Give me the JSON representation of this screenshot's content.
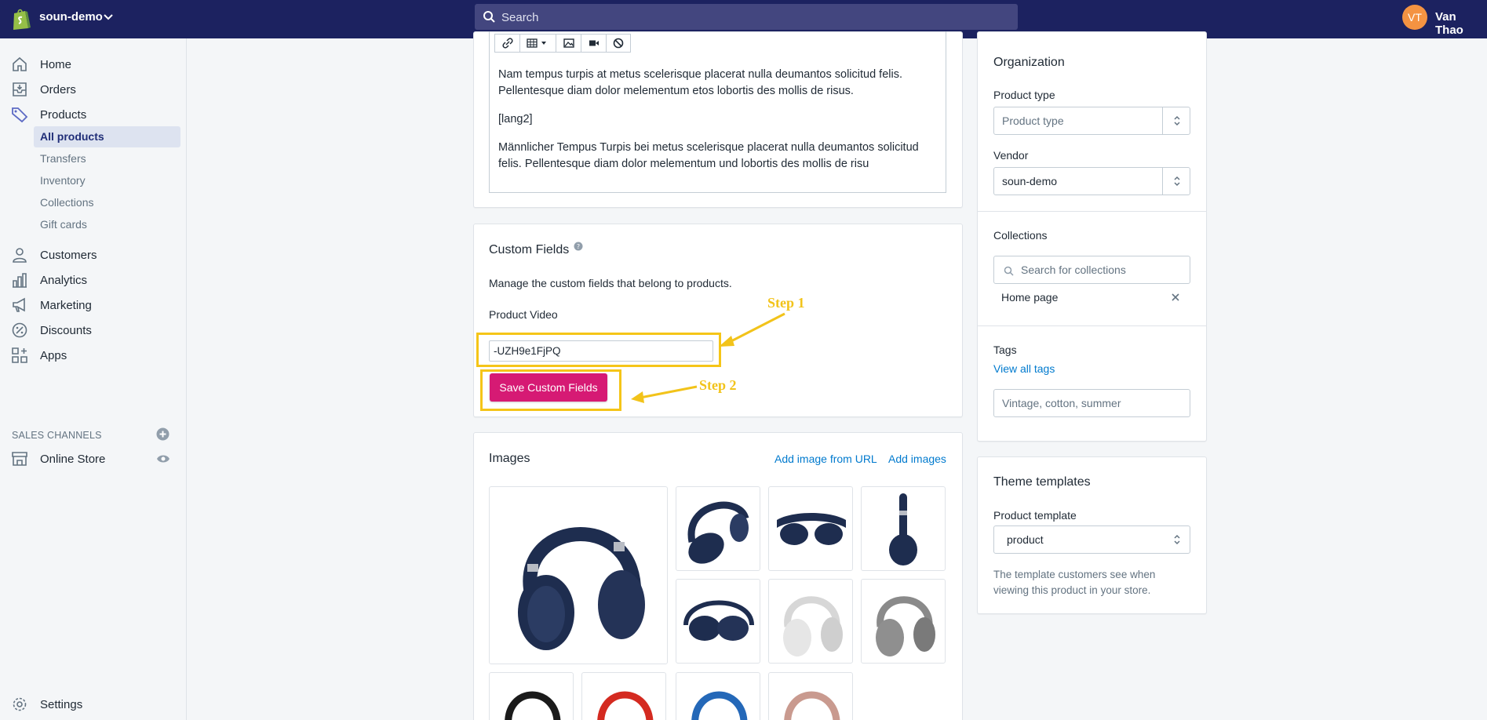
{
  "topbar": {
    "shop_name": "soun-demo",
    "search_placeholder": "Search",
    "avatar_initials": "VT",
    "user_name": "Van Thao"
  },
  "sidebar": {
    "home": "Home",
    "orders": "Orders",
    "products": "Products",
    "sub": [
      "All products",
      "Transfers",
      "Inventory",
      "Collections",
      "Gift cards"
    ],
    "customers": "Customers",
    "analytics": "Analytics",
    "marketing": "Marketing",
    "discounts": "Discounts",
    "apps": "Apps",
    "sales_channels": "SALES CHANNELS",
    "online_store": "Online Store",
    "settings": "Settings"
  },
  "editor": {
    "para1": "Nam tempus turpis at metus scelerisque placerat nulla deumantos solicitud felis. Pellentesque diam dolor melementum etos lobortis des mollis de risus.",
    "para2": "[lang2]",
    "para3": "Männlicher Tempus Turpis bei metus scelerisque placerat nulla deumantos solicitud felis. Pellentesque diam dolor melementum und lobortis des mollis de risu"
  },
  "custom_fields": {
    "title": "Custom Fields",
    "description": "Manage the custom fields that belong to products.",
    "field_label": "Product Video",
    "field_value": "-UZH9e1FjPQ",
    "save_label": "Save Custom Fields",
    "step1": "Step 1",
    "step2": "Step 2"
  },
  "images": {
    "title": "Images",
    "add_url": "Add image from URL",
    "add_images": "Add images"
  },
  "organization": {
    "title": "Organization",
    "product_type_label": "Product type",
    "product_type_placeholder": "Product type",
    "vendor_label": "Vendor",
    "vendor_value": "soun-demo",
    "collections_label": "Collections",
    "collections_placeholder": "Search for collections",
    "collection_item": "Home page",
    "tags_label": "Tags",
    "view_all_tags": "View all tags",
    "tags_placeholder": "Vintage, cotton, summer"
  },
  "theme": {
    "title": "Theme templates",
    "template_label": "Product template",
    "template_value": "product",
    "help": "The template customers see when viewing this product in your store."
  },
  "colors": {
    "topbar": "#1c2260",
    "save_button": "#d61a74",
    "highlight": "#f5c518",
    "link": "#007ace",
    "headphone_blue": "#1e2d4f"
  }
}
